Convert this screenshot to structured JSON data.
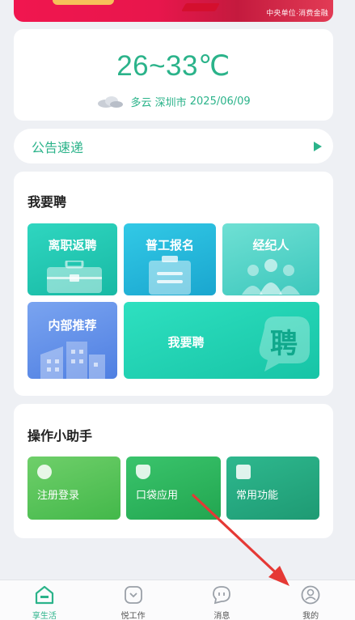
{
  "banner": {
    "caption": "中央单位·消费金融"
  },
  "weather": {
    "temperature": "26~33℃",
    "condition": "多云",
    "city": "深圳市",
    "date": "2025/06/09"
  },
  "notice": {
    "label": "公告速递"
  },
  "recruit": {
    "title": "我要聘",
    "tiles": [
      {
        "label": "离职返聘",
        "icon": "briefcase-icon"
      },
      {
        "label": "普工报名",
        "icon": "clipboard-icon"
      },
      {
        "label": "经纪人",
        "icon": "people-icon"
      },
      {
        "label": "内部推荐",
        "icon": "buildings-icon"
      },
      {
        "label": "我要聘",
        "icon": "pin-badge-icon",
        "badge": "聘"
      }
    ]
  },
  "assistant": {
    "title": "操作小助手",
    "items": [
      {
        "label": "注册登录",
        "icon": "user-add-icon"
      },
      {
        "label": "口袋应用",
        "icon": "pocket-icon"
      },
      {
        "label": "常用功能",
        "icon": "grid-icon"
      }
    ]
  },
  "nav": {
    "items": [
      {
        "label": "享生活",
        "icon": "home-icon",
        "active": true
      },
      {
        "label": "悦工作",
        "icon": "pocket-down-icon",
        "active": false
      },
      {
        "label": "消息",
        "icon": "chat-icon",
        "active": false
      },
      {
        "label": "我的",
        "icon": "profile-icon",
        "active": false
      }
    ]
  },
  "colors": {
    "accent": "#2bb38a",
    "banner": "#e8164c",
    "annotation": "#e53935"
  }
}
